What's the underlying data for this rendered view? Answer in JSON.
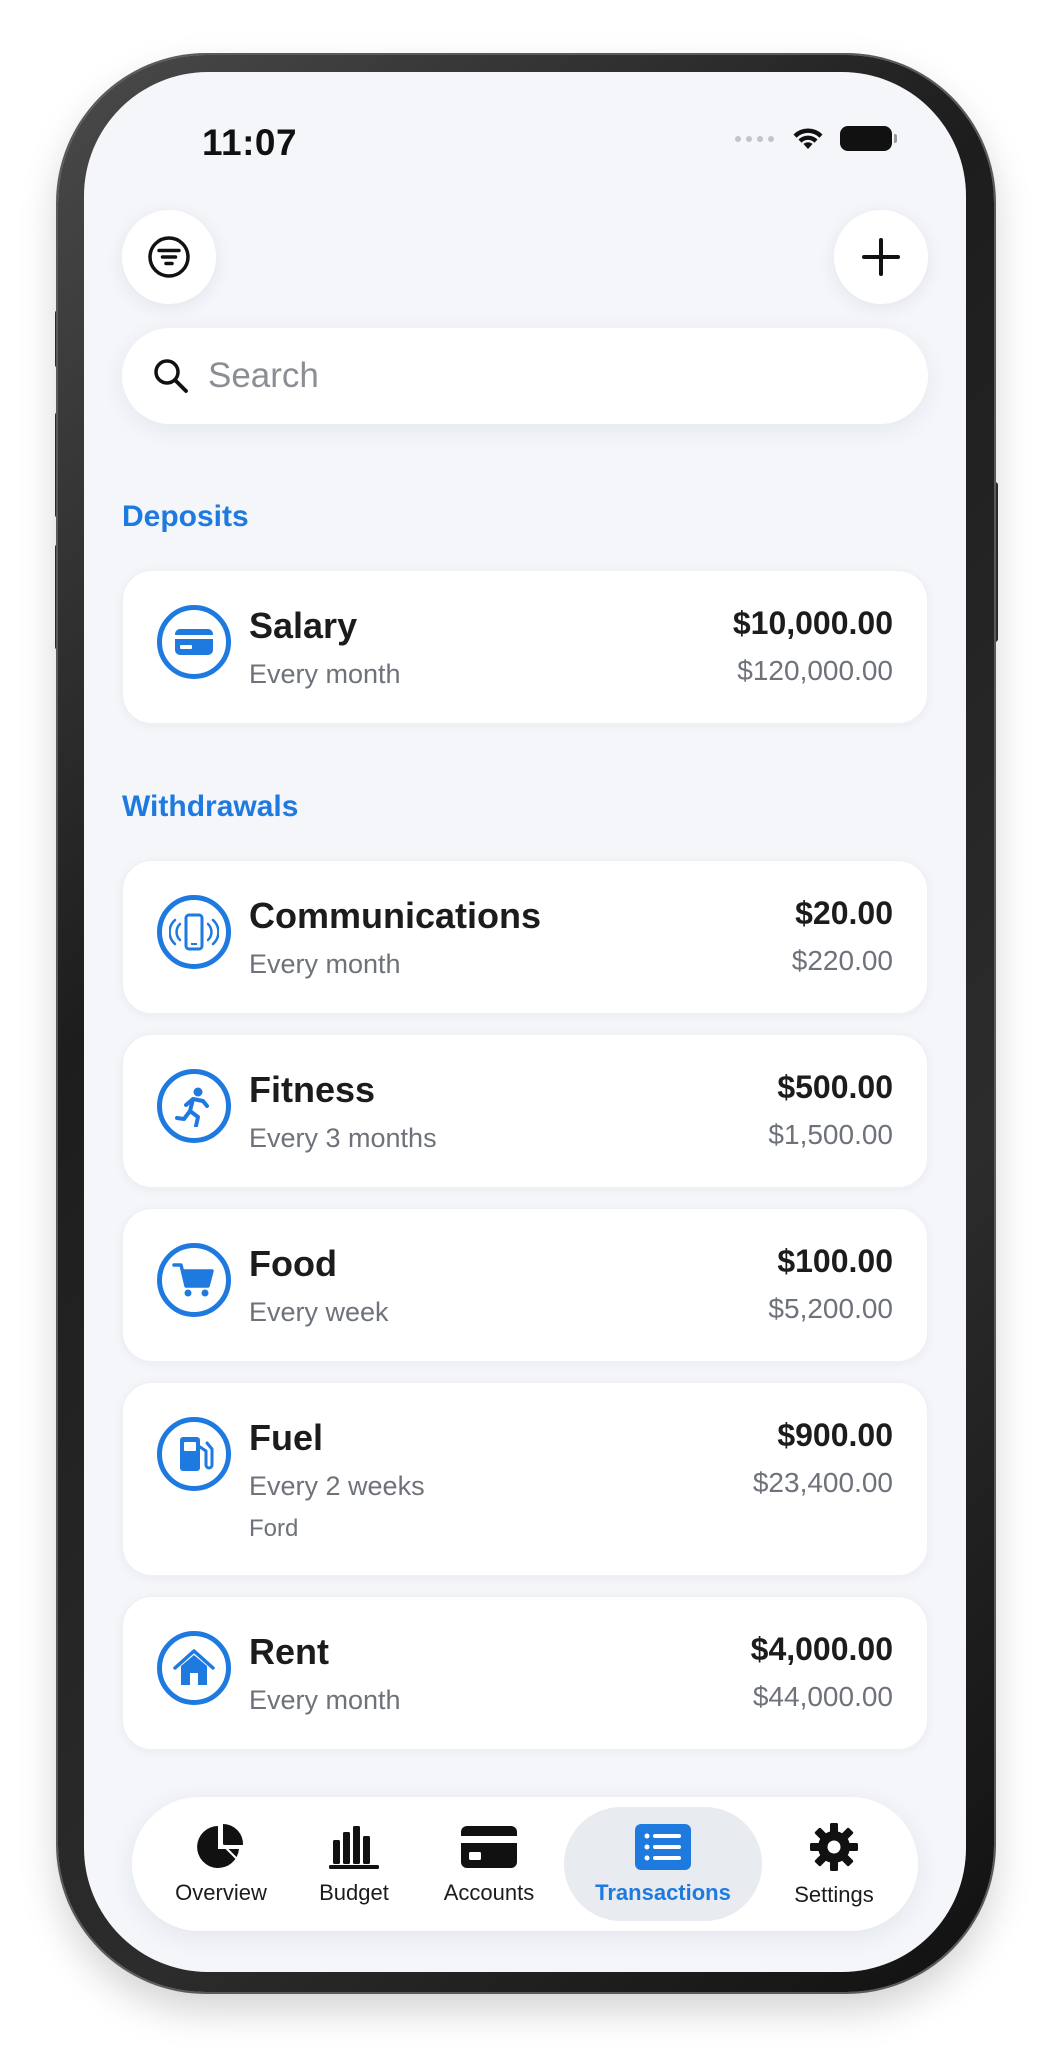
{
  "status_bar": {
    "time": "11:07"
  },
  "toolbar": {
    "filter_icon": "filter-icon",
    "add_icon": "plus-icon"
  },
  "search": {
    "placeholder": "Search"
  },
  "sections": {
    "deposits_title": "Deposits",
    "withdrawals_title": "Withdrawals"
  },
  "deposits": [
    {
      "icon": "credit-card-icon",
      "name": "Salary",
      "frequency": "Every month",
      "amount": "$10,000.00",
      "total": "$120,000.00"
    }
  ],
  "withdrawals": [
    {
      "icon": "phone-icon",
      "name": "Communications",
      "frequency": "Every month",
      "amount": "$20.00",
      "total": "$220.00"
    },
    {
      "icon": "running-person-icon",
      "name": "Fitness",
      "frequency": "Every 3 months",
      "amount": "$500.00",
      "total": "$1,500.00"
    },
    {
      "icon": "shopping-cart-icon",
      "name": "Food",
      "frequency": "Every week",
      "amount": "$100.00",
      "total": "$5,200.00"
    },
    {
      "icon": "fuel-pump-icon",
      "name": "Fuel",
      "frequency": "Every 2 weeks",
      "note": "Ford",
      "amount": "$900.00",
      "total": "$23,400.00"
    },
    {
      "icon": "house-icon",
      "name": "Rent",
      "frequency": "Every month",
      "amount": "$4,000.00",
      "total": "$44,000.00"
    }
  ],
  "tabbar": {
    "tabs": [
      {
        "label": "Overview",
        "icon": "pie-chart-icon"
      },
      {
        "label": "Budget",
        "icon": "bar-chart-icon"
      },
      {
        "label": "Accounts",
        "icon": "wallet-card-icon"
      },
      {
        "label": "Transactions",
        "icon": "list-icon"
      },
      {
        "label": "Settings",
        "icon": "gear-icon"
      }
    ],
    "active": "Transactions"
  },
  "colors": {
    "accent": "#1f7ae0",
    "background": "#f4f6fa",
    "card": "#ffffff"
  }
}
